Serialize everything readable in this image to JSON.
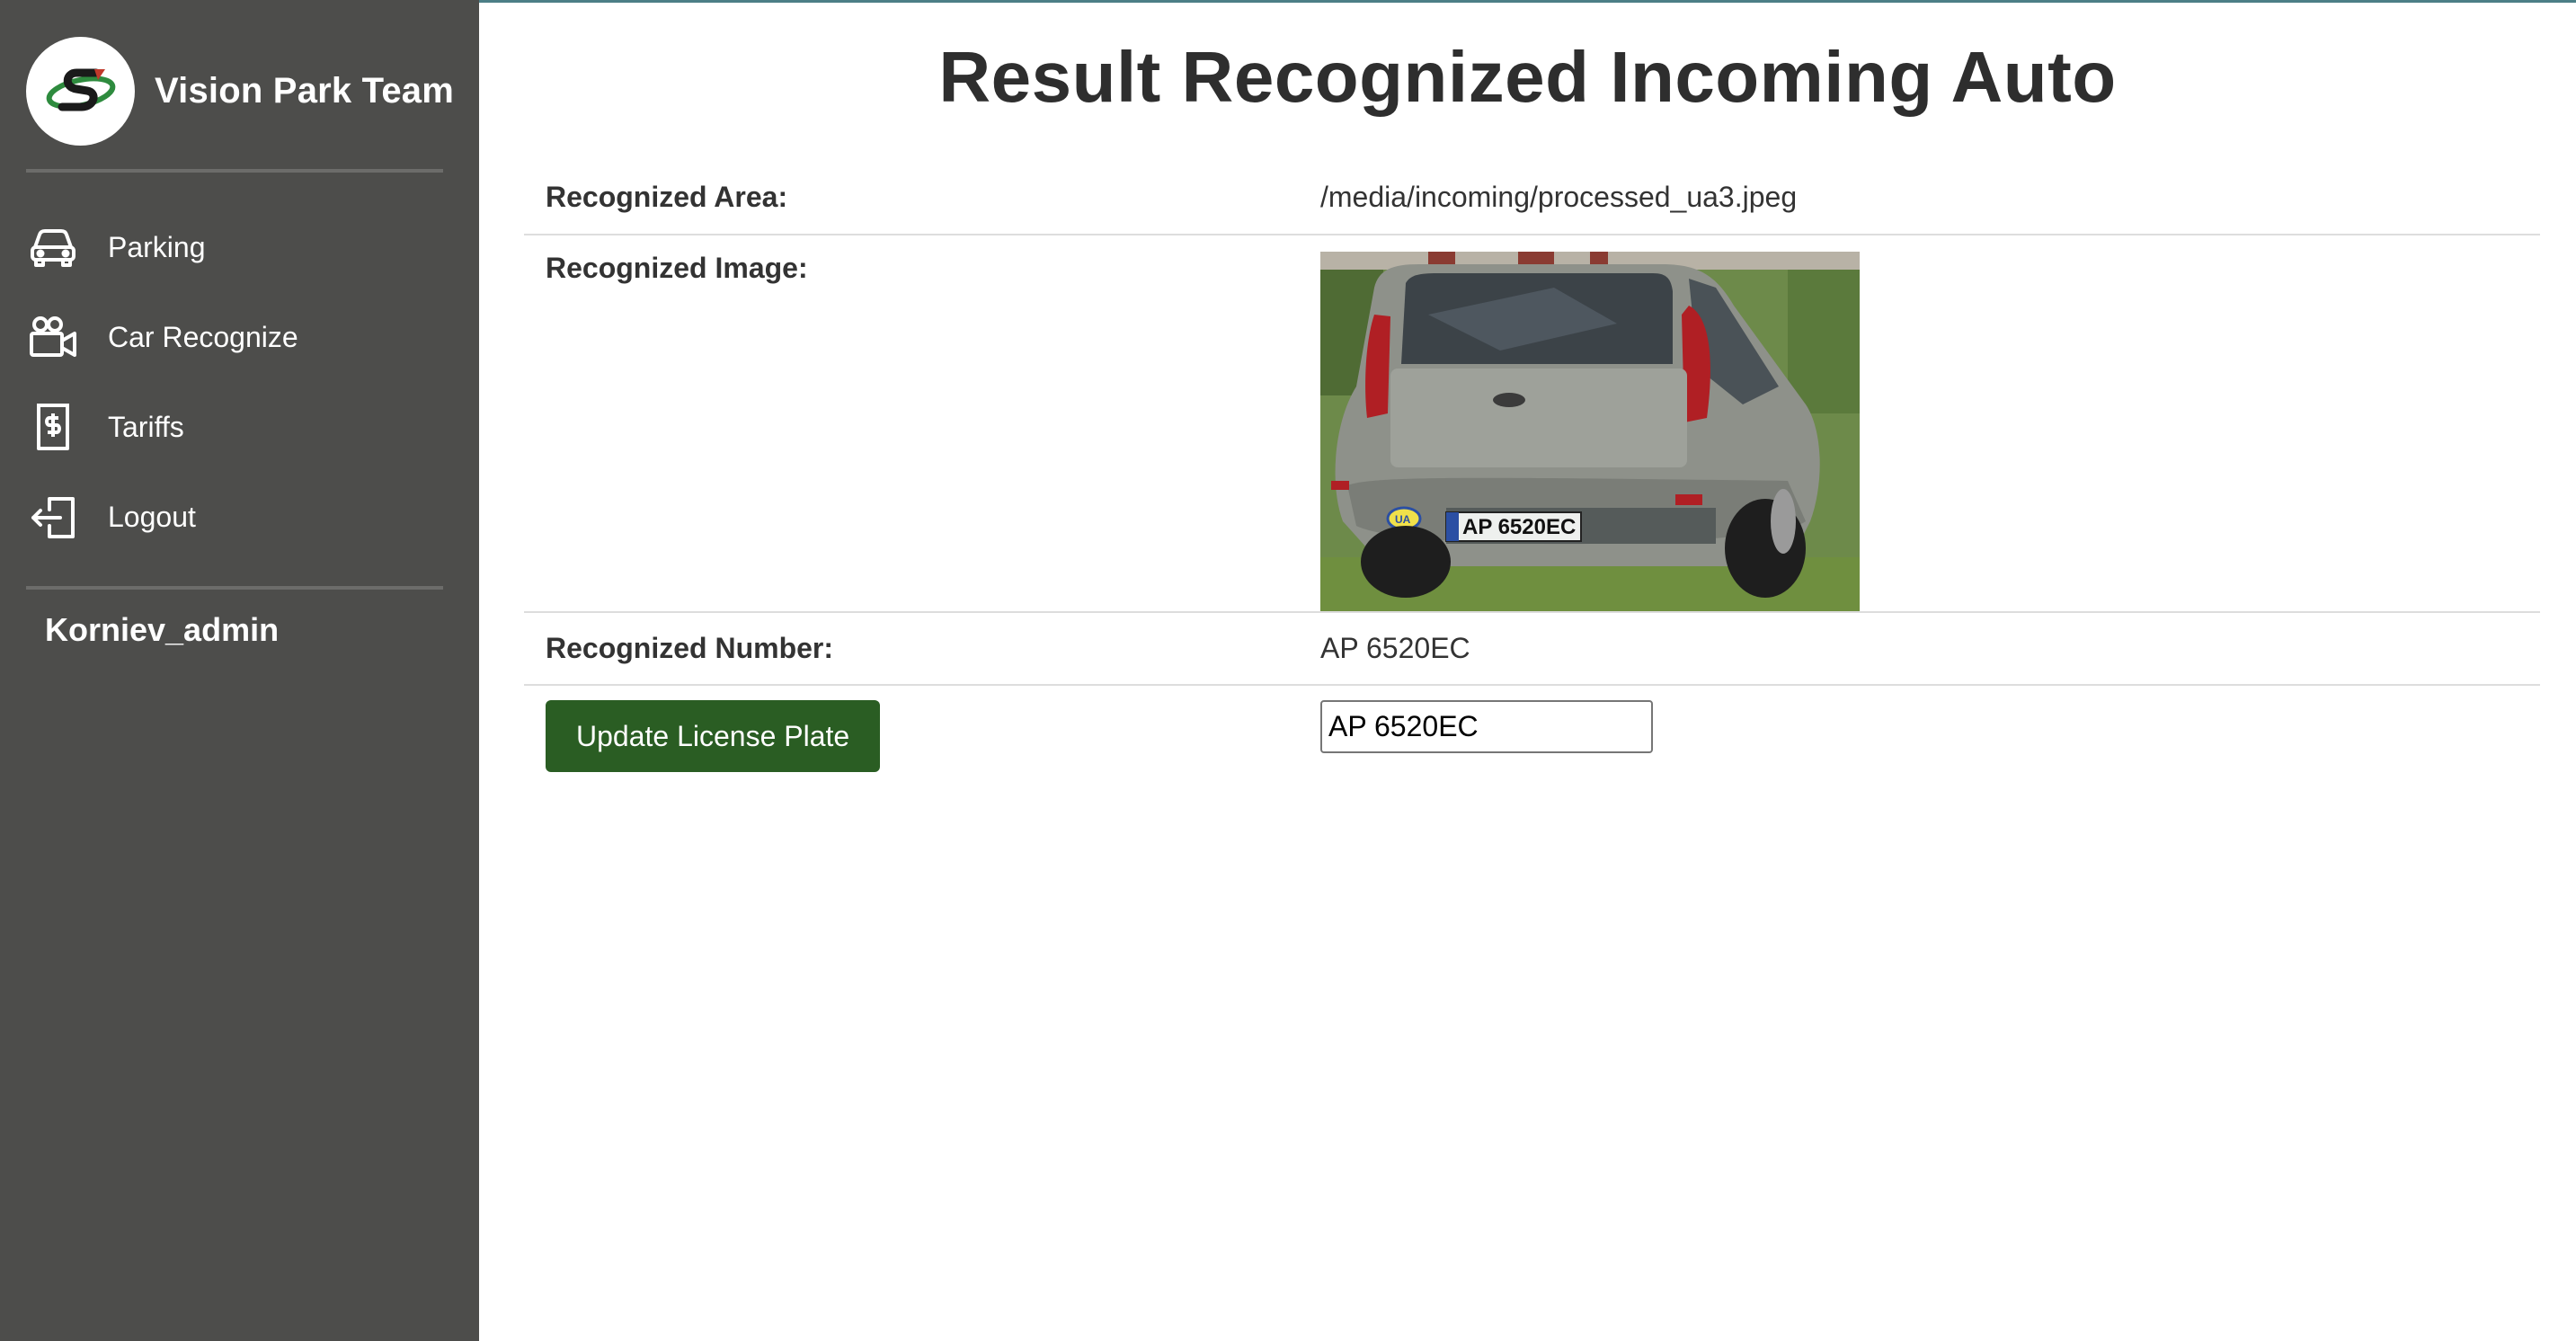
{
  "brand": {
    "name": "Vision Park Team",
    "logo_icon": "vision-park-logo"
  },
  "sidebar": {
    "items": [
      {
        "label": "Parking",
        "icon": "car-icon"
      },
      {
        "label": "Car Recognize",
        "icon": "video-camera-icon"
      },
      {
        "label": "Tariffs",
        "icon": "dollar-receipt-icon"
      },
      {
        "label": "Logout",
        "icon": "logout-icon"
      }
    ],
    "user": "Korniev_admin"
  },
  "main": {
    "title": "Result Recognized Incoming Auto",
    "rows": {
      "area_label": "Recognized Area:",
      "area_value": "/media/incoming/processed_ua3.jpeg",
      "image_label": "Recognized Image:",
      "image_plate_text": "AP 6520EC",
      "image_badge": "UA",
      "number_label": "Recognized Number:",
      "number_value": "AP 6520EC"
    },
    "update": {
      "button_label": "Update License Plate",
      "input_value": "AP 6520EC"
    }
  },
  "colors": {
    "sidebar_bg": "#4d4d4b",
    "button_bg": "#2a5d23",
    "top_line": "#4c7f86"
  }
}
